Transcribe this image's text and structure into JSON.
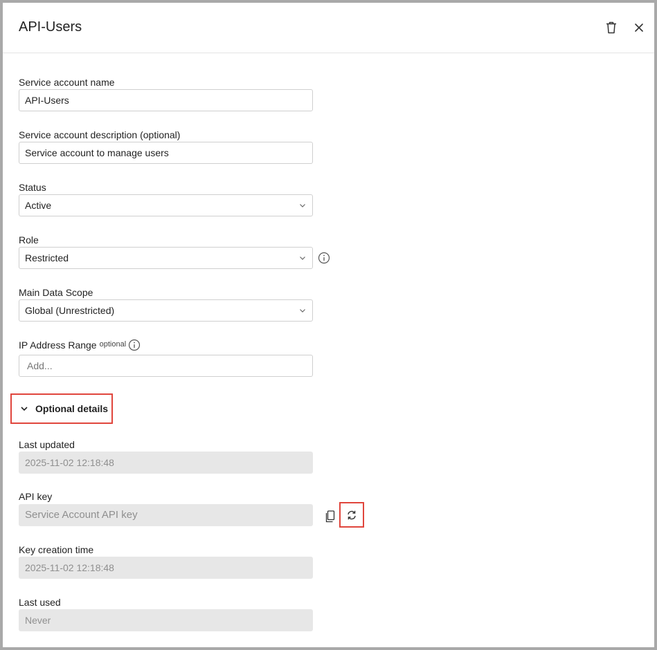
{
  "dialog": {
    "title": "API-Users",
    "icons": {
      "delete": "trash-icon",
      "close": "close-icon"
    }
  },
  "fields": {
    "name": {
      "label": "Service account name",
      "value": "API-Users"
    },
    "description": {
      "label": "Service account description (optional)",
      "value": "Service account to manage users"
    },
    "status": {
      "label": "Status",
      "value": "Active"
    },
    "role": {
      "label": "Role",
      "value": "Restricted",
      "icon": "info-icon"
    },
    "scope": {
      "label": "Main Data Scope",
      "value": "Global (Unrestricted)"
    },
    "ip_range": {
      "label": "IP Address Range",
      "optional_tag": "optional",
      "placeholder": "Add..."
    }
  },
  "optional_details": {
    "toggle_label": "Optional details",
    "expanded": true,
    "last_updated": {
      "label": "Last updated",
      "value": "2025-11-02 12:18:48"
    },
    "api_key": {
      "label": "API key",
      "value": "Service Account API key",
      "icons": [
        "copy-icon",
        "regenerate-icon"
      ]
    },
    "key_creation_time": {
      "label": "Key creation time",
      "value": "2025-11-02 12:18:48"
    },
    "last_used": {
      "label": "Last used",
      "value": "Never"
    }
  },
  "colors": {
    "highlight": "#e0453c",
    "readonly_bg": "#e7e7e7",
    "border": "#cfcfcf"
  }
}
